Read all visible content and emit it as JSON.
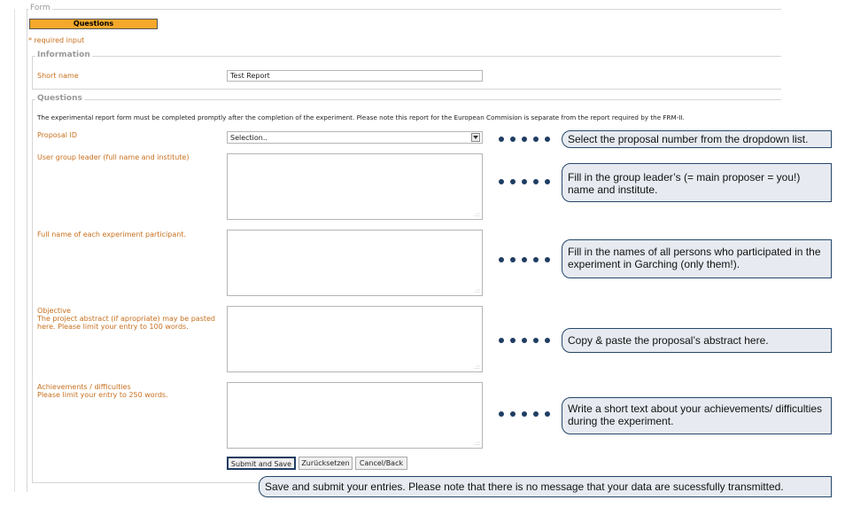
{
  "form": {
    "legend": "Form",
    "questions_tab": "Questions",
    "required_star": "*",
    "required_text": " required input"
  },
  "information": {
    "legend": "Information",
    "short_name_label": "Short name",
    "short_name_value": "Test Report"
  },
  "questions": {
    "legend": "Questions",
    "intro": "The experimental report form must be completed promptly after the completion of the experiment. Please note this report for the European Commision is separate from the report required by the FRM-II.",
    "proposal_label": "Proposal ID",
    "proposal_select_value": "Selection..",
    "group_leader_label": "User group leader (full name and institute)",
    "participants_label": "Full name of each experiment participant.",
    "objective_label": "Objective",
    "objective_hint": "The project abstract (if apropriate) may be pasted here. Please limit your entry to 100 words.",
    "achievements_label": "Achievements / difficulties",
    "achievements_hint": "Please limit your entry to 250 words."
  },
  "buttons": {
    "submit": "Submit and Save",
    "reset": "Zurücksetzen",
    "cancel": "Cancel/Back"
  },
  "callouts": {
    "proposal": "Select the proposal number from the dropdown list.",
    "leader": "Fill in the group leader’s (= main proposer = you!) name and institute.",
    "participants": "Fill in the names of all persons who participated in the experiment in Garching (only them!).",
    "objective": "Copy & paste the proposal’s abstract here.",
    "achievements": "Write a short text about your achievements/ difficulties during the experiment.",
    "submit": "Save and submit your entries. Please note that there is no message that your data are sucessfully transmitted."
  },
  "icons": {
    "dropdown_arrow": "chevron-down-icon",
    "resize_grip": "resize-grip-icon",
    "bullet_dot": "dot-icon"
  },
  "colors": {
    "accent_orange": "#f5a82a",
    "label_orange": "#c8701e",
    "callout_border": "#27476b",
    "callout_bg": "#e7ebf1",
    "dot_blue": "#1f3d63"
  }
}
